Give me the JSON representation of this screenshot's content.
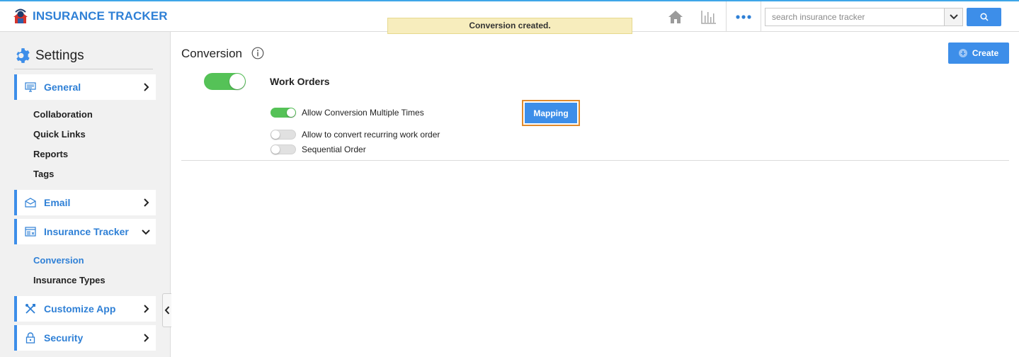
{
  "app": {
    "title": "INSURANCE TRACKER"
  },
  "topbar": {
    "search_placeholder": "search insurance tracker",
    "icons": [
      "home-icon",
      "chart-icon",
      "more-dots-icon",
      "chevron-down-icon",
      "search-icon"
    ]
  },
  "toast": {
    "message": "Conversion created."
  },
  "sidebar": {
    "title": "Settings",
    "sections": [
      {
        "label": "General",
        "icon": "monitor-icon",
        "expanded": false,
        "children": [
          "Collaboration",
          "Quick Links",
          "Reports",
          "Tags"
        ]
      },
      {
        "label": "Email",
        "icon": "envelope-icon",
        "expanded": false,
        "children": []
      },
      {
        "label": "Insurance Tracker",
        "icon": "window-icon",
        "expanded": true,
        "children": [
          "Conversion",
          "Insurance Types"
        ],
        "active_child": "Conversion"
      },
      {
        "label": "Customize App",
        "icon": "tools-icon",
        "expanded": false,
        "children": []
      },
      {
        "label": "Security",
        "icon": "lock-icon",
        "expanded": false,
        "children": []
      }
    ]
  },
  "main": {
    "title": "Conversion",
    "create_label": "Create",
    "section": {
      "title": "Work Orders",
      "enabled": true
    },
    "options": [
      {
        "label": "Allow Conversion Multiple Times",
        "enabled": true
      },
      {
        "label": "Allow to convert recurring work order",
        "enabled": false
      },
      {
        "label": "Sequential Order",
        "enabled": false
      }
    ],
    "mapping_label": "Mapping"
  },
  "colors": {
    "accent": "#3d8ee9",
    "brand_text": "#2f80d6",
    "toggle_on": "#55c257",
    "toast_bg": "#f7edbd",
    "highlight_border": "#e08a2c"
  }
}
